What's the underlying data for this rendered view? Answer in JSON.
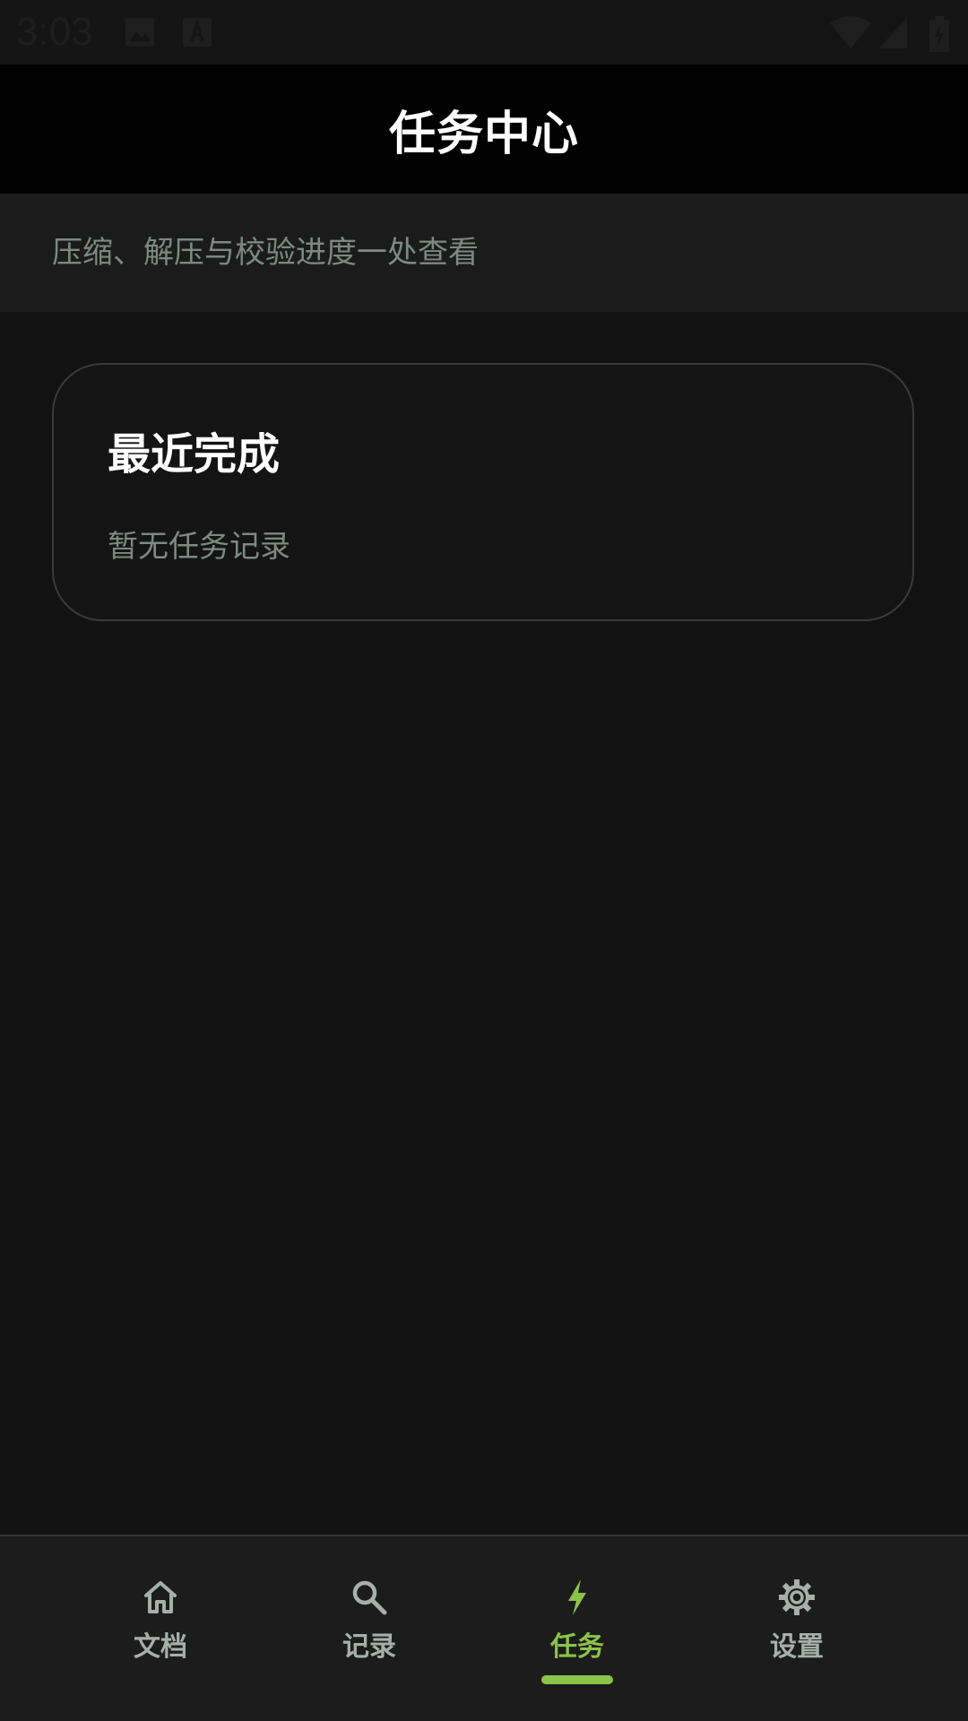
{
  "status_bar": {
    "time": "3:03",
    "icons": [
      "image-icon",
      "a-badge-icon",
      "wifi-icon",
      "signal-icon",
      "battery-icon"
    ]
  },
  "app_bar": {
    "title": "任务中心"
  },
  "subtitle": "压缩、解压与校验进度一处查看",
  "recent_card": {
    "title": "最近完成",
    "empty_text": "暂无任务记录"
  },
  "bottom_nav": {
    "items": [
      {
        "label": "文档",
        "icon": "home-icon",
        "active": false
      },
      {
        "label": "记录",
        "icon": "search-icon",
        "active": false
      },
      {
        "label": "任务",
        "icon": "bolt-icon",
        "active": true
      },
      {
        "label": "设置",
        "icon": "gear-icon",
        "active": false
      }
    ]
  },
  "colors": {
    "background": "#121212",
    "app_bar": "#000000",
    "accent": "#8bc34a",
    "muted_text": "#7b8a82",
    "nav_inactive": "#a5b0aa"
  }
}
